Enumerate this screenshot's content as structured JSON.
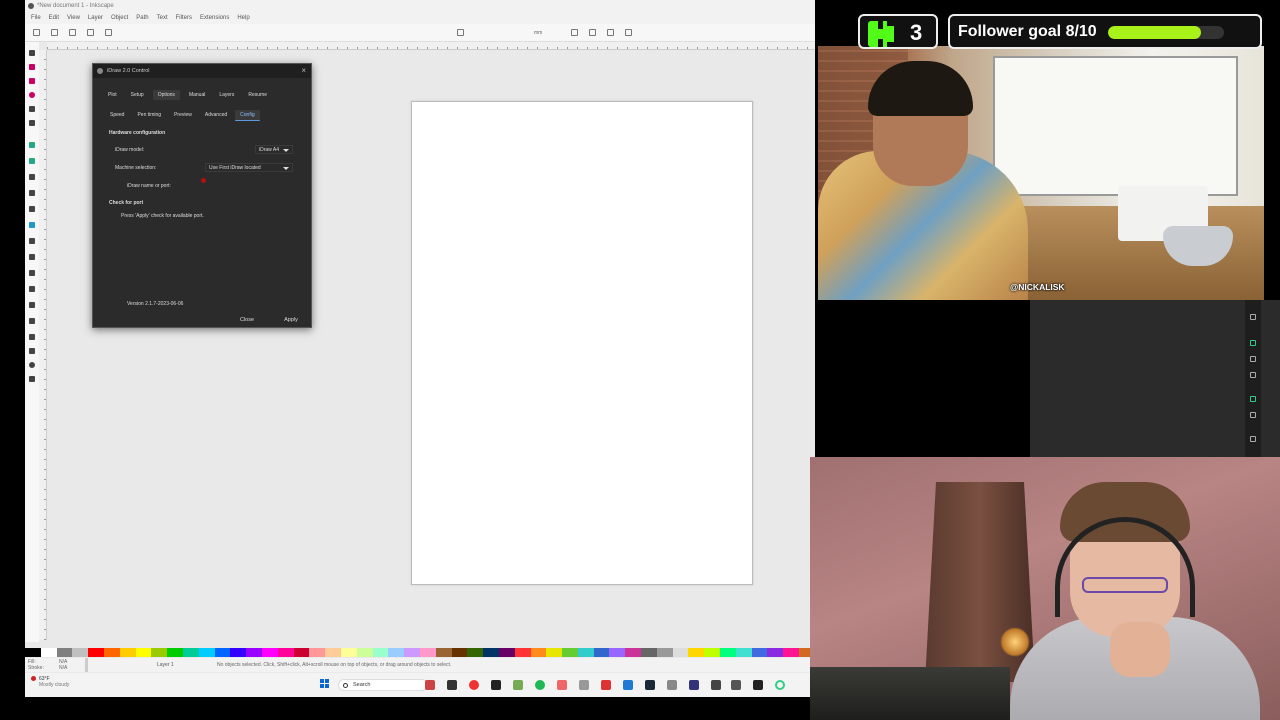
{
  "inkscape": {
    "title": "*New document 1 - Inkscape",
    "menu": [
      "File",
      "Edit",
      "View",
      "Layer",
      "Object",
      "Path",
      "Text",
      "Filters",
      "Extensions",
      "Help"
    ],
    "units": "mm",
    "status_text": "No objects selected. Click, Shift+click, Alt+scroll mouse on top of objects, or drag around objects to select.",
    "layer": "Layer 1",
    "fill_label": "Fill:",
    "stroke_label": "Stroke:",
    "fill_value": "N/A",
    "stroke_value": "N/A",
    "palette": [
      "#000000",
      "#ffffff",
      "#808080",
      "#c0c0c0",
      "#ff0000",
      "#ff6600",
      "#ffcc00",
      "#ffff00",
      "#99cc00",
      "#00cc00",
      "#00cc99",
      "#00ccff",
      "#0066ff",
      "#3300ff",
      "#9900ff",
      "#ff00ff",
      "#ff0099",
      "#cc0033",
      "#ff9999",
      "#ffcc99",
      "#ffff99",
      "#ccff99",
      "#99ffcc",
      "#99ccff",
      "#cc99ff",
      "#ff99cc",
      "#996633",
      "#663300",
      "#336600",
      "#003366",
      "#660066",
      "#ff3333",
      "#ff8c1a",
      "#e6e600",
      "#66cc33",
      "#33cccc",
      "#3366cc",
      "#9966ff",
      "#cc3399",
      "#666666",
      "#999999",
      "#dddddd",
      "#ffd700",
      "#c0ff00",
      "#00ff7f",
      "#40e0d0",
      "#4169e1",
      "#8a2be2",
      "#ff1493",
      "#d2691e"
    ]
  },
  "dialog": {
    "title": "iDraw 2.0 Control",
    "tabs": [
      "Plot",
      "Setup",
      "Options",
      "Manual",
      "Layers",
      "Resume"
    ],
    "active_tab": "Options",
    "subtabs": [
      "Speed",
      "Pen timing",
      "Preview",
      "Advanced",
      "Config"
    ],
    "active_subtab": "Config",
    "section_hw": "Hardware configuration",
    "model_label": "iDraw model:",
    "model_value": "iDraw A4",
    "machine_label": "Machine selection:",
    "machine_value": "Use First iDraw located",
    "name_label": "iDraw name or port:",
    "section_port": "Check for port",
    "port_hint": "Press 'Apply' check for available port.",
    "version": "Version 2.1.7-2023-06-06",
    "close_btn": "Close",
    "apply_btn": "Apply"
  },
  "taskbar": {
    "weather_temp": "63°F",
    "weather_desc": "Mostly cloudy",
    "search_label": "Search"
  },
  "overlay": {
    "follower_goal_label": "Follower goal 8/10",
    "follower_goal_progress": 0.8,
    "kick_count": "3",
    "kick_color": "#53fc18",
    "goal_bar_color": "#a8f21a",
    "cam1_name": "@NICKALISK"
  }
}
